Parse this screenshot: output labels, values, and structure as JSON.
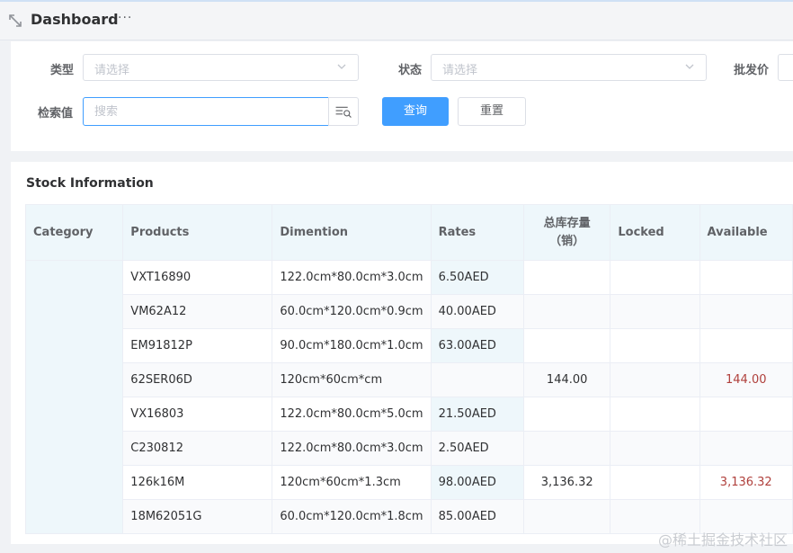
{
  "header": {
    "title": "Dashboard",
    "more": "···"
  },
  "filters": {
    "type_label": "类型",
    "type_placeholder": "请选择",
    "status_label": "状态",
    "status_placeholder": "请选择",
    "wholesale_label": "批发价",
    "search_label": "检索值",
    "search_placeholder": "搜索",
    "query_button": "查询",
    "reset_button": "重置"
  },
  "section_title": "Stock Information",
  "table": {
    "columns": [
      "Category",
      "Products",
      "Dimention",
      "Rates",
      "总库存量",
      "（销）",
      "Locked",
      "Available"
    ],
    "rows": [
      {
        "product": "VXT16890",
        "dimension": "122.0cm*80.0cm*3.0cm",
        "rate": "6.50AED",
        "total": "",
        "locked": "",
        "available": ""
      },
      {
        "product": "VM62A12",
        "dimension": "60.0cm*120.0cm*0.9cm",
        "rate": "40.00AED",
        "total": "",
        "locked": "",
        "available": ""
      },
      {
        "product": "EM91812P",
        "dimension": "90.0cm*180.0cm*1.0cm",
        "rate": "63.00AED",
        "total": "",
        "locked": "",
        "available": ""
      },
      {
        "product": "62SER06D",
        "dimension": "120cm*60cm*cm",
        "rate": "",
        "total": "144.00",
        "locked": "",
        "available": "144.00"
      },
      {
        "product": "VX16803",
        "dimension": "122.0cm*80.0cm*5.0cm",
        "rate": "21.50AED",
        "total": "",
        "locked": "",
        "available": ""
      },
      {
        "product": "C230812",
        "dimension": "122.0cm*80.0cm*3.0cm",
        "rate": "2.50AED",
        "total": "",
        "locked": "",
        "available": ""
      },
      {
        "product": "126k16M",
        "dimension": "120cm*60cm*1.3cm",
        "rate": "98.00AED",
        "total": "3,136.32",
        "locked": "",
        "available": "3,136.32"
      },
      {
        "product": "18M62051G",
        "dimension": "60.0cm*120.0cm*1.8cm",
        "rate": "85.00AED",
        "total": "",
        "locked": "",
        "available": ""
      }
    ]
  },
  "watermark": "@稀土掘金技术社区",
  "colors": {
    "primary": "#409eff",
    "available_text": "#b0403c",
    "header_bg": "#eef7fb"
  }
}
